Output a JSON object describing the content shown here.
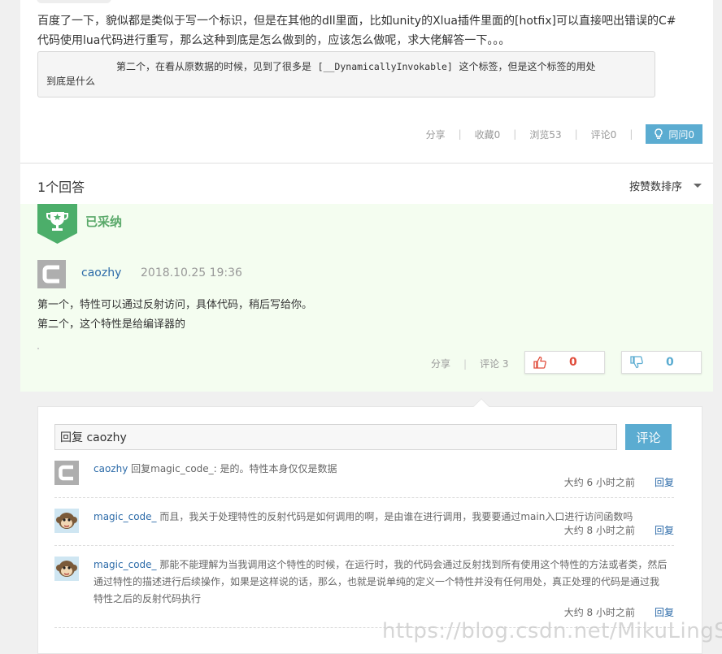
{
  "question": {
    "body": "百度了一下，貌似都是类似于写一个标识，但是在其他的dll里面，比如unity的Xlua插件里面的[hotfix]可以直接吧出错误的C#代码使用lua代码进行重写，那么这种到底是怎么做到的，应该怎么做呢，求大佬解答一下。。。",
    "code_line1_prefix": "第二个，在看从原数据的时候，见到了很多是",
    "code_attr": "[__DynamicallyInvokable]",
    "code_line1_suffix": "这个标签，但是这个标签的用处",
    "code_line2": "到底是什么",
    "actions": {
      "share": "分享",
      "favorite": "收藏0",
      "views": "浏览53",
      "comments": "评论0",
      "same_question": "同问0"
    }
  },
  "answers_header": {
    "count": "1个回答",
    "sort": "按赞数排序"
  },
  "accepted_answer": {
    "label": "已采纳",
    "user": "caozhy",
    "time": "2018.10.25 19:36",
    "line1": "第一个，特性可以通过反射访问，具体代码，稍后写给你。",
    "line2": "第二个，这个特性是给编译器的",
    "actions": {
      "share": "分享",
      "comments": "评论 3"
    },
    "upvotes": "0",
    "downvotes": "0"
  },
  "comments": {
    "input_value": "回复 caozhy",
    "submit": "评论",
    "items": [
      {
        "user": "caozhy",
        "text": " 回复magic_code_: 是的。特性本身仅仅是数据",
        "time": "大约 6 小时之前",
        "reply": "回复"
      },
      {
        "user": "magic_code_",
        "text": " 而且，我关于处理特性的反射代码是如何调用的啊，是由谁在进行调用，我要要通过main入口进行访问函数吗",
        "time": "大约 8 小时之前",
        "reply": "回复"
      },
      {
        "user": "magic_code_",
        "text": " 那能不能理解为当我调用这个特性的时候，在运行时，我的代码会通过反射找到所有使用这个特性的方法或者类，然后通过特性的描述进行后续操作，如果是这样说的话，那么，也就是说单纯的定义一个特性并没有任何用处，真正处理的代码是通过我特性之后的反射代码执行",
        "time": "大约 8 小时之前",
        "reply": "回复"
      }
    ]
  },
  "watermark": "https://blog.csdn.net/MikuLingSSS",
  "colors": {
    "accent_blue": "#5bacd1",
    "link_blue": "#2b6aa8",
    "accepted_green": "#5aa96a",
    "accepted_bg": "#f4fdf0",
    "upvote_red": "#e04c3a"
  }
}
